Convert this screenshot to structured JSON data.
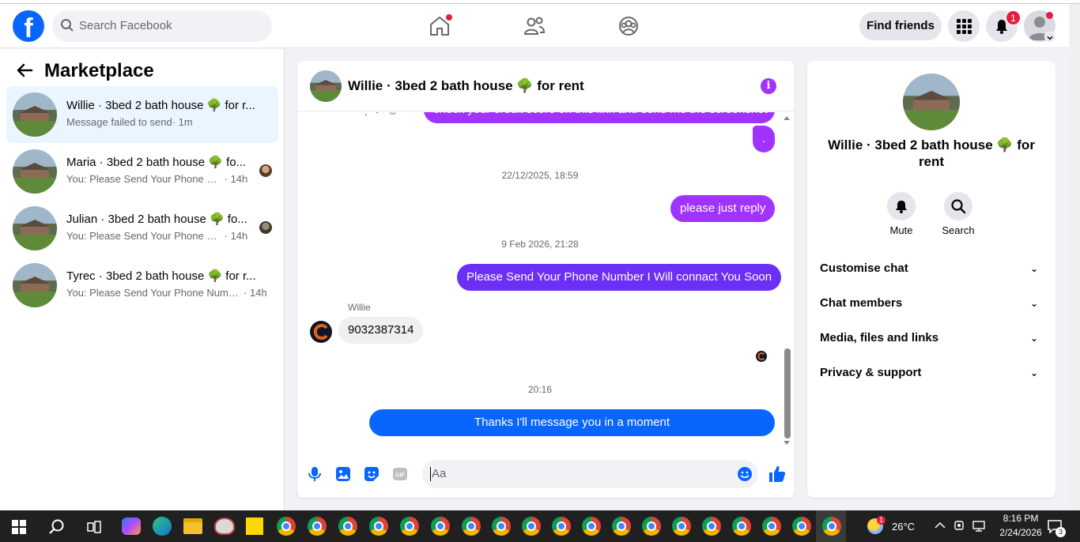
{
  "topnav": {
    "logo": "f",
    "search_placeholder": "Search Facebook",
    "find_friends": "Find friends",
    "notification_count": "1"
  },
  "marketplace": {
    "title": "Marketplace",
    "conversations": [
      {
        "name": "Willie · 3bed 2 bath house 🌳 for r...",
        "preview": "Message failed to send",
        "time": "· 1m"
      },
      {
        "name": "Maria · 3bed 2 bath house 🌳 fo...",
        "preview": "You: Please Send Your Phone Nu...",
        "time": "· 14h"
      },
      {
        "name": "Julian · 3bed 2 bath house 🌳 fo...",
        "preview": "You: Please Send Your Phone Nu...",
        "time": "· 14h"
      },
      {
        "name": "Tyrec · 3bed 2 bath house 🌳 for r...",
        "preview": "You: Please Send Your Phone Numbe...",
        "time": "· 14h"
      }
    ]
  },
  "chat": {
    "title": "Willie · 3bed 2 bath house 🌳 for rent",
    "info_icon": "i",
    "messages": {
      "cut_message": "check your credit score on this link and send me the screenshot",
      "dot_message": ".",
      "stamp1": "22/12/2025, 18:59",
      "msg_please_reply": "please just reply",
      "stamp2": "9 Feb 2026, 21:28",
      "msg_phone_request": "Please Send Your Phone Number I Will connact You Soon",
      "sender_name": "Willie",
      "msg_phone_number": "9032387314",
      "stamp3": "20:16",
      "msg_thanks": "Thanks I'll message you in a moment"
    },
    "composer_placeholder": "Aa"
  },
  "details": {
    "title": "Willie · 3bed 2 bath house 🌳 for rent",
    "mute_label": "Mute",
    "search_label": "Search",
    "sections": [
      "Customise chat",
      "Chat members",
      "Media, files and links",
      "Privacy & support"
    ]
  },
  "taskbar": {
    "weather": "26°C",
    "weather_badge": "1",
    "time": "8:16 PM",
    "date": "2/24/2026",
    "notif_count": "3"
  },
  "colors": {
    "fb_blue": "#0866ff",
    "purple": "#a033ff",
    "indigo": "#6b2ff5"
  }
}
